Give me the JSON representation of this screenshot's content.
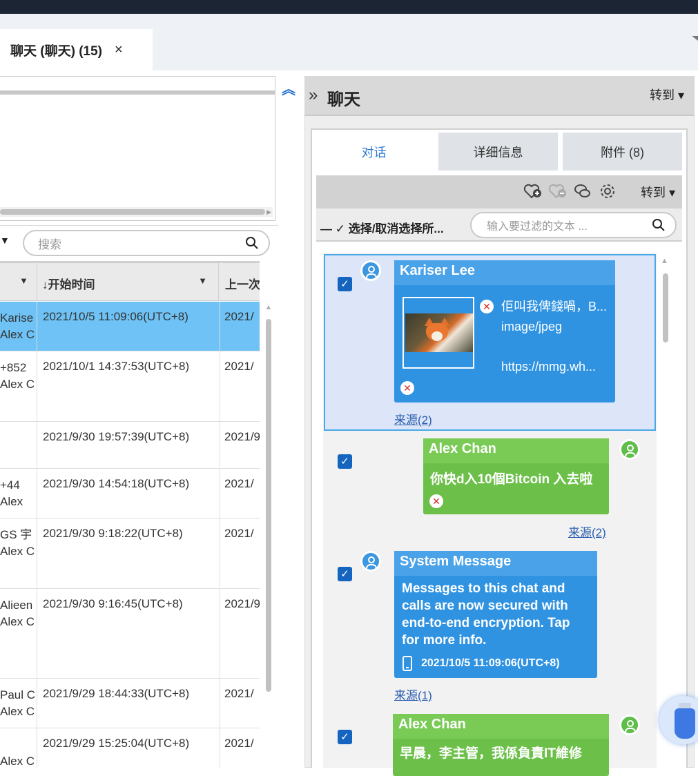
{
  "tab": {
    "label": "聊天 (聊天) (15)",
    "close": "×"
  },
  "left": {
    "search_placeholder": "搜索",
    "columns": {
      "col1_dd": "▼",
      "start_time": "↓开始时间",
      "last": "上一次"
    },
    "rows": [
      {
        "col1": [
          "Karise",
          "Alex C"
        ],
        "start": "2021/10/5 11:09:06(UTC+8)",
        "last": "2021/",
        "selected": true
      },
      {
        "col1": [
          "+852",
          "Alex C"
        ],
        "start": "2021/10/1 14:37:53(UTC+8)",
        "last": "2021/"
      },
      {
        "col1": [
          "",
          ""
        ],
        "start": "2021/9/30 19:57:39(UTC+8)",
        "last": "2021/9"
      },
      {
        "col1": [
          " +44 ",
          " Alex"
        ],
        "start": "2021/9/30 14:54:18(UTC+8)",
        "last": "2021/"
      },
      {
        "col1": [
          "GS 宇",
          "Alex C"
        ],
        "start": "2021/9/30 9:18:22(UTC+8)",
        "last": "2021/"
      },
      {
        "col1": [
          "Alieen",
          "Alex C"
        ],
        "start": "2021/9/30 9:16:45(UTC+8)",
        "last": "2021/9"
      },
      {
        "col1": [
          "Paul C",
          "Alex C"
        ],
        "start": "2021/9/29 18:44:33(UTC+8)",
        "last": "2021/"
      },
      {
        "col1": [
          "",
          "Alex C"
        ],
        "start": "2021/9/29 15:25:04(UTC+8)",
        "last": "2021/"
      }
    ]
  },
  "right": {
    "title": "聊天",
    "goto": "转到",
    "tabs": [
      "对话",
      "详细信息",
      "附件 (8)"
    ],
    "toolbar_goto": "转到",
    "select_label": "选择/取消选择所...",
    "filter_placeholder": "输入要过滤的文本 ...",
    "messages": [
      {
        "sender": "Kariser Lee",
        "att_title": "佢叫我俾錢喎，B...",
        "att_type": "image/jpeg",
        "att_url": "https://mmg.wh...",
        "source": "来源(2)"
      },
      {
        "sender": "Alex Chan",
        "text": "你快d入10個Bitcoin 入去啦",
        "source": "来源(2)"
      },
      {
        "sender": "System Message",
        "text": "Messages to this chat and calls are now secured with end-to-end encryption. Tap for more info.",
        "time": "2021/10/5 11:09:06(UTC+8)",
        "source": "来源(1)"
      },
      {
        "sender": "Alex Chan",
        "text": "早晨，李主管，我係負責IT維修"
      }
    ]
  }
}
